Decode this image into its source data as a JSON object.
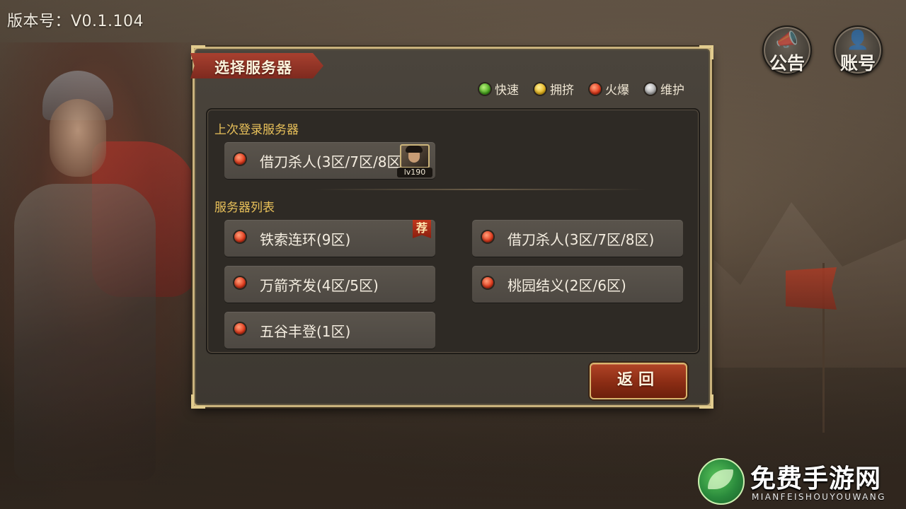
{
  "version_label": "版本号：V0.1.104",
  "top_buttons": {
    "notice": "公告",
    "account": "账号"
  },
  "dialog": {
    "title": "选择服务器",
    "legend": [
      {
        "label": "快速",
        "color": "#43a11b"
      },
      {
        "label": "拥挤",
        "color": "#e5b117"
      },
      {
        "label": "火爆",
        "color": "#e23a1c"
      },
      {
        "label": "维护",
        "color": "#a9a9a9"
      }
    ],
    "last_login_label": "上次登录服务器",
    "last_login": {
      "name": "借刀杀人(3区/7区/8区)",
      "status": "火爆",
      "level": "lv190"
    },
    "server_list_label": "服务器列表",
    "servers": [
      {
        "name": "铁索连环(9区)",
        "status": "火爆",
        "tag": "荐"
      },
      {
        "name": "借刀杀人(3区/7区/8区)",
        "status": "火爆"
      },
      {
        "name": "万箭齐发(4区/5区)",
        "status": "火爆"
      },
      {
        "name": "桃园结义(2区/6区)",
        "status": "火爆"
      },
      {
        "name": "五谷丰登(1区)",
        "status": "火爆"
      }
    ],
    "back_button": "返回"
  },
  "watermark": {
    "title": "免费手游网",
    "subtitle": "MIANFEISHOUYOUWANG"
  }
}
